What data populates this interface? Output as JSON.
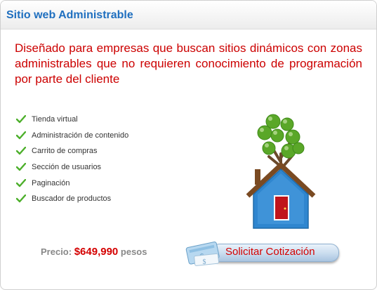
{
  "header": {
    "title": "Sitio web Administrable"
  },
  "lead": "Diseñado para empresas que buscan sitios dinámicos con zonas administrables que no requieren conocimiento de programación por parte del cliente",
  "features": [
    "Tienda virtual",
    "Administración de contenido",
    "Carrito de compras",
    "Sección de usuarios",
    "Paginación",
    "Buscador de productos"
  ],
  "price": {
    "label": "Precio:",
    "amount": "$649,990",
    "unit": "pesos"
  },
  "cta": {
    "label": "Solicitar Cotización"
  },
  "colors": {
    "title": "#1f6fbf",
    "accent": "#cc0000",
    "check": "#4caf2a",
    "house": "#2f86cf"
  }
}
